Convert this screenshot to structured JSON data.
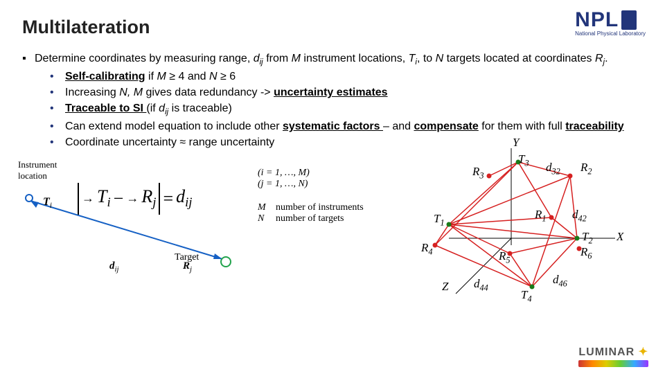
{
  "title": "Multilateration",
  "logo": {
    "text": "NPL",
    "sub": "National Physical Laboratory"
  },
  "main_bullet_glyph": "▪",
  "sub_bullet_glyph": "•",
  "main_text": {
    "pre": "Determine coordinates by measuring range, ",
    "d": "d",
    "ij": "ij",
    "mid1": " from ",
    "M": "M",
    "mid2": " instrument locations, ",
    "T": "T",
    "i": "i",
    "mid3": ",  to ",
    "N": "N",
    "mid4": " targets located at coordinates ",
    "R": "R",
    "j2": "j",
    "end": "."
  },
  "sub": [
    {
      "parts": [
        {
          "t": "Self-calibrating",
          "cls": "b ul"
        },
        {
          "t": " if "
        },
        {
          "t": "M",
          "cls": "i"
        },
        {
          "t": " ≥ 4 and "
        },
        {
          "t": "N",
          "cls": "i"
        },
        {
          "t": " ≥ 6"
        }
      ]
    },
    {
      "parts": [
        {
          "t": "Increasing "
        },
        {
          "t": "N, M",
          "cls": "i"
        },
        {
          "t": " gives data redundancy -> "
        },
        {
          "t": "uncertainty estimates",
          "cls": "b ul"
        }
      ]
    },
    {
      "parts": [
        {
          "t": "Traceable to SI ",
          "cls": "b ul"
        },
        {
          "t": "(if "
        },
        {
          "t": "d",
          "cls": "i"
        },
        {
          "sub": "ij"
        },
        {
          "t": " is traceable)"
        }
      ]
    },
    {
      "parts": [
        {
          "t": "Can extend model equation to include other "
        },
        {
          "t": "systematic factors ",
          "cls": "b ul"
        },
        {
          "t": "– and "
        },
        {
          "t": "compensate",
          "cls": "b ul"
        },
        {
          "t": " for them with full "
        },
        {
          "t": "traceability",
          "cls": "b ul"
        }
      ]
    },
    {
      "parts": [
        {
          "t": "Coordinate uncertainty ≈ range uncertainty"
        }
      ]
    }
  ],
  "left_panel": {
    "inst": "Instrument\nlocation",
    "Ti": "T",
    "Ti_sub": "i",
    "Rj": "R",
    "Rj_sub": "j",
    "dij": "d",
    "dij_sub": "ij",
    "target": "Target"
  },
  "equation": {
    "T": "T",
    "Ti": "i",
    "m": " − ",
    "R": "R",
    "Rj": "j",
    "eq": " = ",
    "d": "d",
    "dij": "ij"
  },
  "mid1_a": "(i = 1, …, M)",
  "mid1_b": "(j = 1, …, N)",
  "mid2_a1": "M",
  "mid2_a2": "number of instruments",
  "mid2_b1": "N",
  "mid2_b2": "number of targets",
  "diagram_labels": {
    "Y": "Y",
    "X": "X",
    "Z": "Z",
    "T1": "T",
    "T1s": "1",
    "T2": "T",
    "T2s": "2",
    "T3": "T",
    "T3s": "3",
    "T4": "T",
    "T4s": "4",
    "R1": "R",
    "R1s": "1",
    "R2": "R",
    "R2s": "2",
    "R3": "R",
    "R3s": "3",
    "R4": "R",
    "R4s": "4",
    "R5": "R",
    "R5s": "5",
    "R6": "R",
    "R6s": "6",
    "d32": "d",
    "d32s": "32",
    "d42": "d",
    "d42s": "42",
    "d44": "d",
    "d44s": "44",
    "d46": "d",
    "d46s": "46"
  },
  "luminar": "LUMINAR"
}
